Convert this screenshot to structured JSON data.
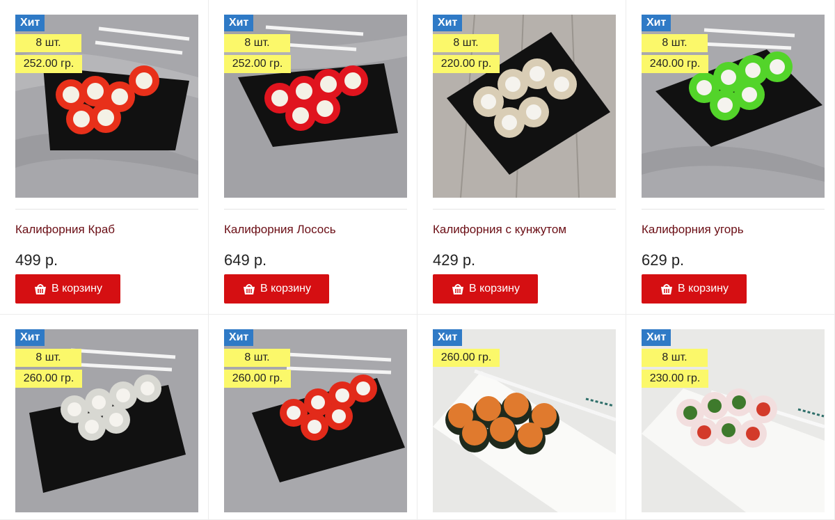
{
  "products": [
    {
      "hit": "Хит",
      "qty": "8 шт.",
      "weight": "252.00 гр.",
      "name": "Калифорния Краб",
      "price": "499 р.",
      "button": "В корзину",
      "topping_color": "#e8301a"
    },
    {
      "hit": "Хит",
      "qty": "8 шт.",
      "weight": "252.00 гр.",
      "name": "Калифорния Лосось",
      "price": "649 р.",
      "button": "В корзину",
      "topping_color": "#e0141e"
    },
    {
      "hit": "Хит",
      "qty": "8 шт.",
      "weight": "220.00 гр.",
      "name": "Калифорния с кунжутом",
      "price": "429 р.",
      "button": "В корзину",
      "topping_color": "#d9cdb5"
    },
    {
      "hit": "Хит",
      "qty": "8 шт.",
      "weight": "240.00 гр.",
      "name": "Калифорния угорь",
      "price": "629 р.",
      "button": "В корзину",
      "topping_color": "#53d42a"
    },
    {
      "hit": "Хит",
      "qty": "8 шт.",
      "weight": "260.00 гр.",
      "topping_color": "#d8d8d2"
    },
    {
      "hit": "Хит",
      "qty": "8 шт.",
      "weight": "260.00 гр.",
      "topping_color": "#e22a1a"
    },
    {
      "hit": "Хит",
      "qty": "",
      "weight": "260.00 гр.",
      "topping_color": "#e07a2e"
    },
    {
      "hit": "Хит",
      "qty": "8 шт.",
      "weight": "230.00 гр.",
      "topping_color": "#f2dede"
    }
  ],
  "colors": {
    "hit_badge": "#2f7ac6",
    "tag_bg": "#fbf86a",
    "button": "#d50f12",
    "name": "#6a0d14"
  },
  "icons": {
    "cart": "basket-icon"
  }
}
